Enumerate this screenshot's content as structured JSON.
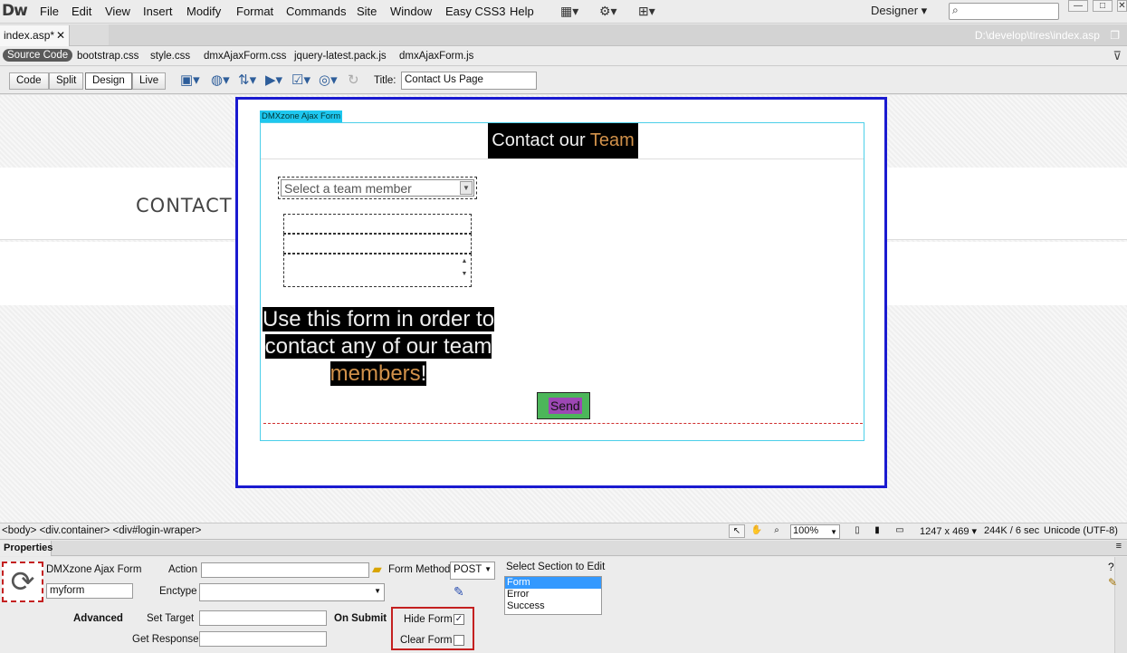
{
  "app": {
    "logo": "Dw",
    "menu": [
      "File",
      "Edit",
      "View",
      "Insert",
      "Modify",
      "Format",
      "Commands",
      "Site",
      "Window",
      "Easy CSS3",
      "Help"
    ],
    "workspace": "Designer ▾"
  },
  "document": {
    "tab_label": "index.asp*",
    "path": "D:\\develop\\tires\\index.asp"
  },
  "related_files": {
    "source_code": "Source Code",
    "files": [
      "bootstrap.css",
      "style.css",
      "dmxAjaxForm.css",
      "jquery-latest.pack.js",
      "dmxAjaxForm.js"
    ]
  },
  "doc_toolbar": {
    "views": [
      "Code",
      "Split",
      "Design",
      "Live"
    ],
    "active_view": "Design",
    "title_label": "Title:",
    "title_value": "Contact Us Page"
  },
  "canvas": {
    "contact_heading": "CONTACT",
    "form_tag": "DMXzone Ajax Form",
    "form_title_plain": "Contact our ",
    "form_title_accent": "Team",
    "select_placeholder": "Select a team member",
    "intro_line1": "Use this form in order to",
    "intro_line2": "contact any of our team",
    "intro_accent": "members",
    "intro_end": "!",
    "send_label": "Send"
  },
  "status_bar": {
    "tag_path": "<body> <div.container> <div#login-wraper>",
    "zoom": "100%",
    "dimensions": "1247 x 469 ▾",
    "size_time": "244K / 6 sec",
    "encoding": "Unicode (UTF-8)"
  },
  "properties": {
    "panel_title": "Properties",
    "component_name": "DMXzone Ajax Form",
    "form_id": "myform",
    "action_label": "Action",
    "action_value": "",
    "form_method_label": "Form Method",
    "form_method_value": "POST",
    "enctype_label": "Enctype",
    "enctype_value": "",
    "select_section_label": "Select Section to Edit",
    "sections": [
      "Form",
      "Error",
      "Success"
    ],
    "selected_section": "Form",
    "advanced_label": "Advanced",
    "set_target_label": "Set Target",
    "get_response_label": "Get Response",
    "on_submit_label": "On Submit",
    "hide_form_label": "Hide Form",
    "hide_form_checked": true,
    "clear_form_label": "Clear Form",
    "clear_form_checked": false
  },
  "colors": {
    "accent": "#d1914a",
    "wrapper_border": "#1a1ad0",
    "form_border": "#4ccfe9",
    "send_bg": "#4cb65a",
    "send_label_bg": "#9c47b4",
    "highlight": "#c42020"
  }
}
